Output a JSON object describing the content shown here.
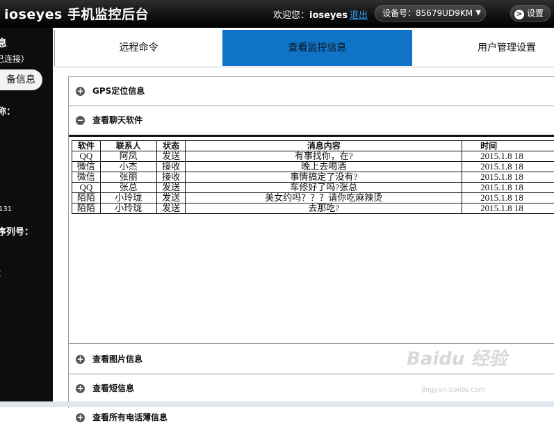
{
  "header": {
    "app_title": "ioseyes 手机监控后台",
    "welcome_prefix": "欢迎您：",
    "username": "ioseyes",
    "logout": "退出",
    "device_label": "设备号：85679UD9KM",
    "settings": "设置"
  },
  "sidebar": {
    "title": "息",
    "status": "已连接）",
    "device_button": "备信息",
    "nickname_label": "称：",
    "number_fragment": "131",
    "serial_label": "序列号：",
    "version_label": "："
  },
  "tabs": [
    {
      "label": "远程命令",
      "active": false
    },
    {
      "label": "查看监控信息",
      "active": true
    },
    {
      "label": "用户管理设置",
      "active": false
    }
  ],
  "accordion": [
    {
      "label": "GPS定位信息",
      "expanded": false
    },
    {
      "label": "查看聊天软件",
      "expanded": true
    },
    {
      "label": "查看图片信息",
      "expanded": false
    },
    {
      "label": "查看短信息",
      "expanded": false
    },
    {
      "label": "查看所有电话薄信息",
      "expanded": false
    }
  ],
  "chat_table": {
    "headers": [
      "软件",
      "联系人",
      "状态",
      "消息内容",
      "时间"
    ],
    "rows": [
      [
        "QQ",
        "阿凤",
        "发送",
        "有事找你，在?",
        "2015.1.8 18"
      ],
      [
        "微信",
        "小杰",
        "接收",
        "晚上去喝酒",
        "2015.1.8 18"
      ],
      [
        "微信",
        "张丽",
        "接收",
        "事情搞定了没有?",
        "2015.1.8 18"
      ],
      [
        "QQ",
        "张总",
        "发送",
        "车修好了吗?张总",
        "2015.1.8 18"
      ],
      [
        "陌陌",
        "小玲珑",
        "发送",
        "美女约吗？？？请你吃麻辣烫",
        "2015.1.8 18"
      ],
      [
        "陌陌",
        "小玲珑",
        "发送",
        "去那吃?",
        "2015.1.8 18"
      ]
    ]
  },
  "watermark": {
    "main": "Baidu 经验",
    "sub": "jingyan.baidu.com"
  },
  "icons": {
    "expand": "plus-circle-icon",
    "collapse": "minus-circle-icon",
    "settings_arrow": "chevron-right-icon",
    "dropdown": "chevron-down-icon"
  }
}
